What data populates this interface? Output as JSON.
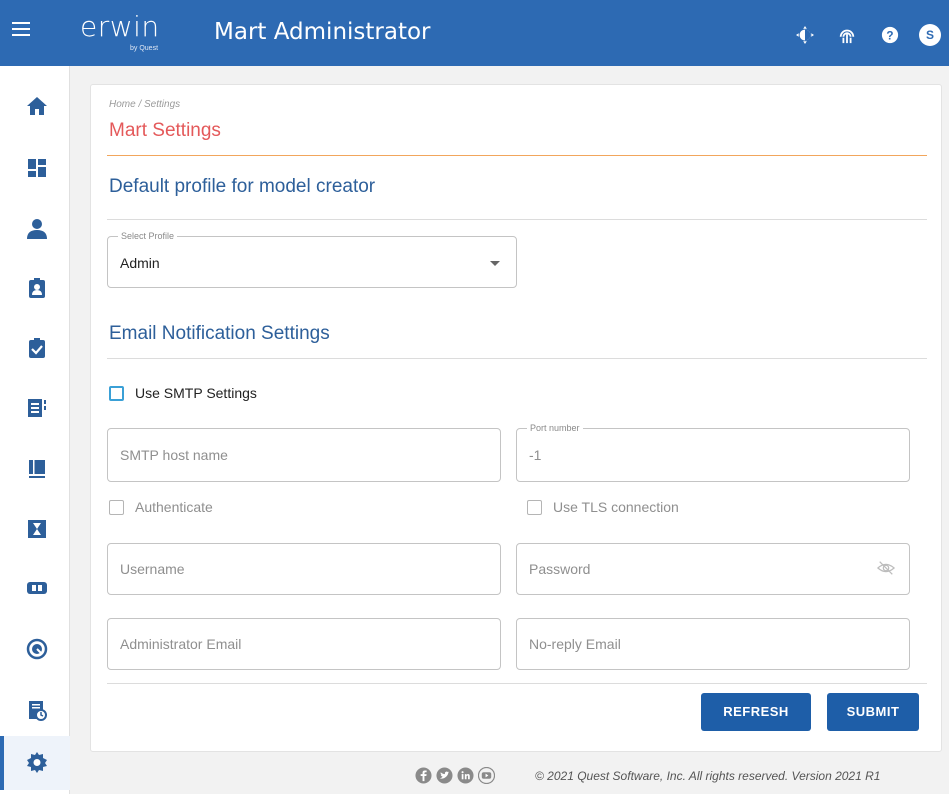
{
  "header": {
    "brand": "erwin",
    "brand_sub": "by Quest",
    "app_title": "Mart Administrator",
    "avatar_initial": "S",
    "icons": [
      "hamburger-menu-icon",
      "theme-toggle-icon",
      "connection-icon",
      "help-icon",
      "user-avatar"
    ]
  },
  "sidebar": {
    "items": [
      {
        "icon": "home-icon"
      },
      {
        "icon": "dashboard-icon"
      },
      {
        "icon": "user-icon"
      },
      {
        "icon": "user-badge-icon"
      },
      {
        "icon": "clipboard-check-icon"
      },
      {
        "icon": "catalog-icon"
      },
      {
        "icon": "book-icon"
      },
      {
        "icon": "hourglass-icon"
      },
      {
        "icon": "connector-icon"
      },
      {
        "icon": "session-icon"
      },
      {
        "icon": "report-schedule-icon"
      },
      {
        "icon": "gear-icon",
        "active": true
      }
    ]
  },
  "main": {
    "breadcrumb": "Home / Settings",
    "page_title": "Mart Settings",
    "profile_section": {
      "title": "Default profile for model creator",
      "select_legend": "Select Profile",
      "select_value": "Admin"
    },
    "email_section": {
      "title": "Email Notification Settings",
      "use_smtp_label": "Use SMTP Settings",
      "smtp_host_placeholder": "SMTP host name",
      "port_legend": "Port number",
      "port_value": "-1",
      "authenticate_label": "Authenticate",
      "tls_label": "Use TLS connection",
      "username_placeholder": "Username",
      "password_placeholder": "Password",
      "admin_email_placeholder": "Administrator Email",
      "noreply_email_placeholder": "No-reply Email"
    },
    "buttons": {
      "refresh": "REFRESH",
      "submit": "SUBMIT"
    }
  },
  "footer": {
    "social_icons": [
      "facebook-icon",
      "twitter-icon",
      "linkedin-icon",
      "youtube-icon"
    ],
    "text": "© 2021 Quest Software, Inc. All rights reserved. Version 2021 R1"
  },
  "colors": {
    "header_bg": "#2d6ab3",
    "title_red": "#e4595a",
    "section_blue": "#2d5f9a",
    "button_blue": "#1e5ea8",
    "accent_rule": "#f2a65c"
  }
}
